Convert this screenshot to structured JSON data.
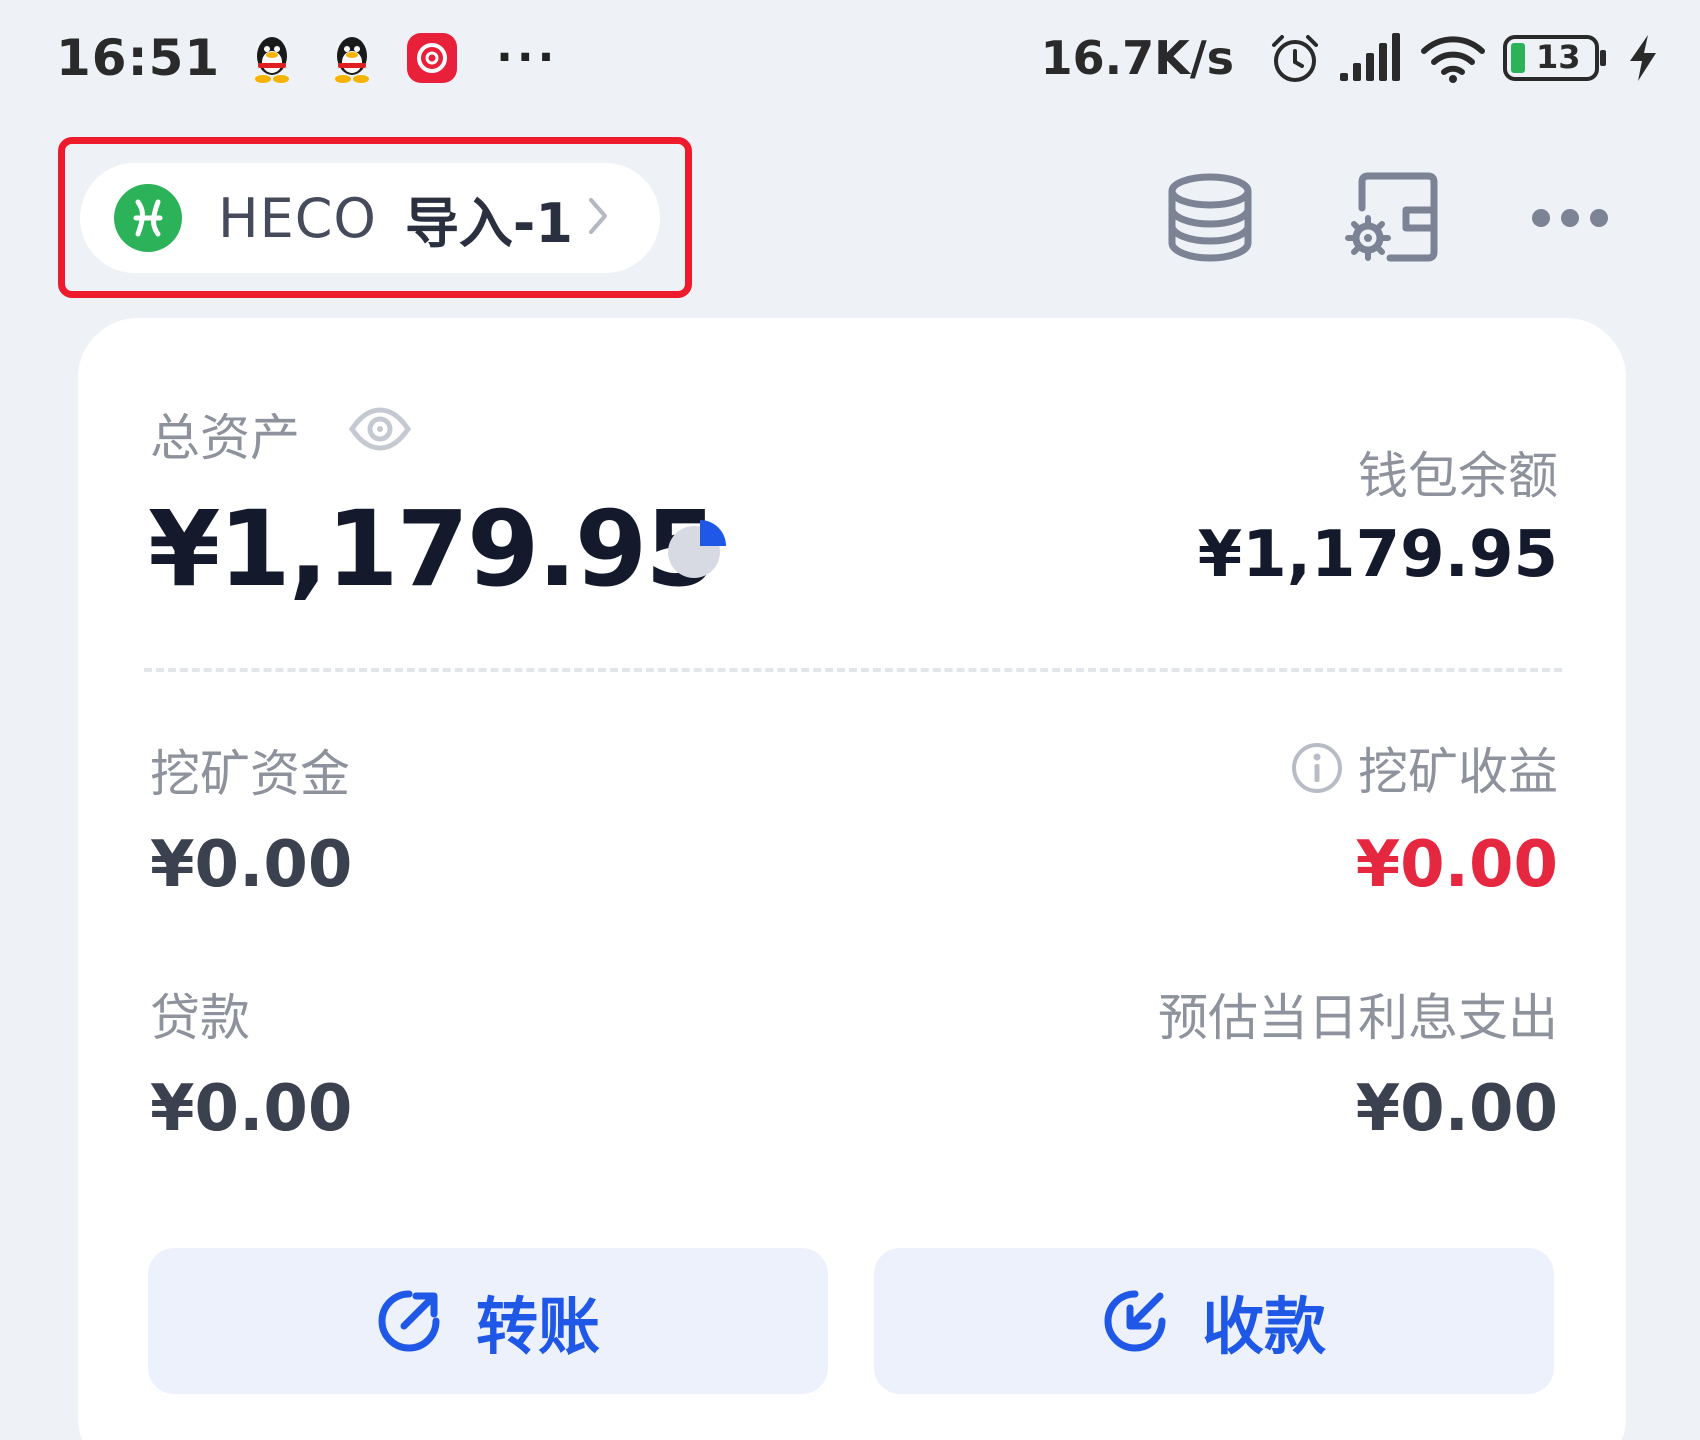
{
  "status_bar": {
    "time": "16:51",
    "more": "···",
    "net_speed": "16.7K/s",
    "battery": "13",
    "icons": [
      "qq-icon",
      "qq-icon",
      "app-red-icon",
      "alarm-icon",
      "signal-icon",
      "wifi-icon",
      "battery-icon",
      "charging-icon"
    ]
  },
  "header": {
    "chain": "HECO",
    "wallet": "导入-1",
    "chain_icon": "heco-logo",
    "actions": [
      "coins-stack-icon",
      "wallet-settings-icon",
      "more-icon"
    ]
  },
  "assets": {
    "total_label": "总资产",
    "total_value": "¥1,179.95",
    "wallet_balance_label": "钱包余额",
    "wallet_balance_value": "¥1,179.95",
    "mining_funds_label": "挖矿资金",
    "mining_funds_value": "¥0.00",
    "mining_income_label": "挖矿收益",
    "mining_income_value": "¥0.00",
    "loan_label": "贷款",
    "loan_value": "¥0.00",
    "daily_interest_label": "预估当日利息支出",
    "daily_interest_value": "¥0.00"
  },
  "actions": {
    "transfer": "转账",
    "receive": "收款"
  },
  "colors": {
    "background": "#eef2f6",
    "accent_blue": "#1f57e6",
    "income_red": "#e5283f",
    "highlight_red": "#ee1b2c",
    "heco_green": "#2cb35a"
  }
}
